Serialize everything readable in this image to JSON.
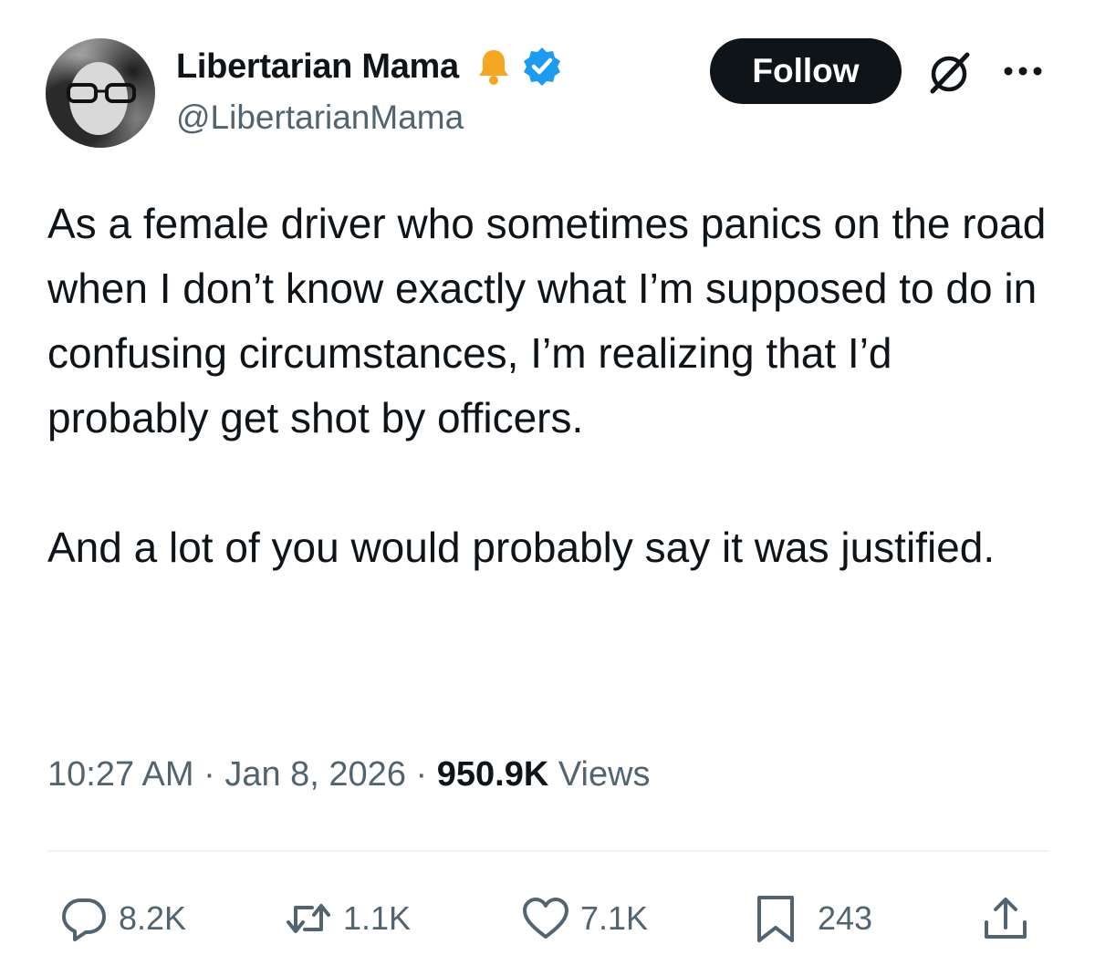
{
  "author": {
    "display_name": "Libertarian Mama",
    "handle": "@LibertarianMama"
  },
  "header": {
    "follow_label": "Follow",
    "icons": [
      "bell-icon",
      "verified-badge-icon",
      "grok-icon",
      "more-icon"
    ]
  },
  "tweet": {
    "paragraphs": [
      "As a female driver who sometimes panics on the road when I don’t know exactly what I’m supposed to do in confusing circumstances, I’m realizing that I’d probably get shot by officers.",
      "And a lot of you would probably say it was justified."
    ]
  },
  "meta": {
    "time": "10:27 AM",
    "separator": "·",
    "date": "Jan 8, 2026",
    "views_count": "950.9K",
    "views_label": "Views"
  },
  "actions": {
    "replies": "8.2K",
    "reposts": "1.1K",
    "likes": "7.1K",
    "bookmarks": "243"
  },
  "colors": {
    "text": "#0f1419",
    "secondary": "#536471",
    "verified": "#1d9bf0",
    "bell": "#f5a623",
    "divider": "#eff3f4"
  }
}
